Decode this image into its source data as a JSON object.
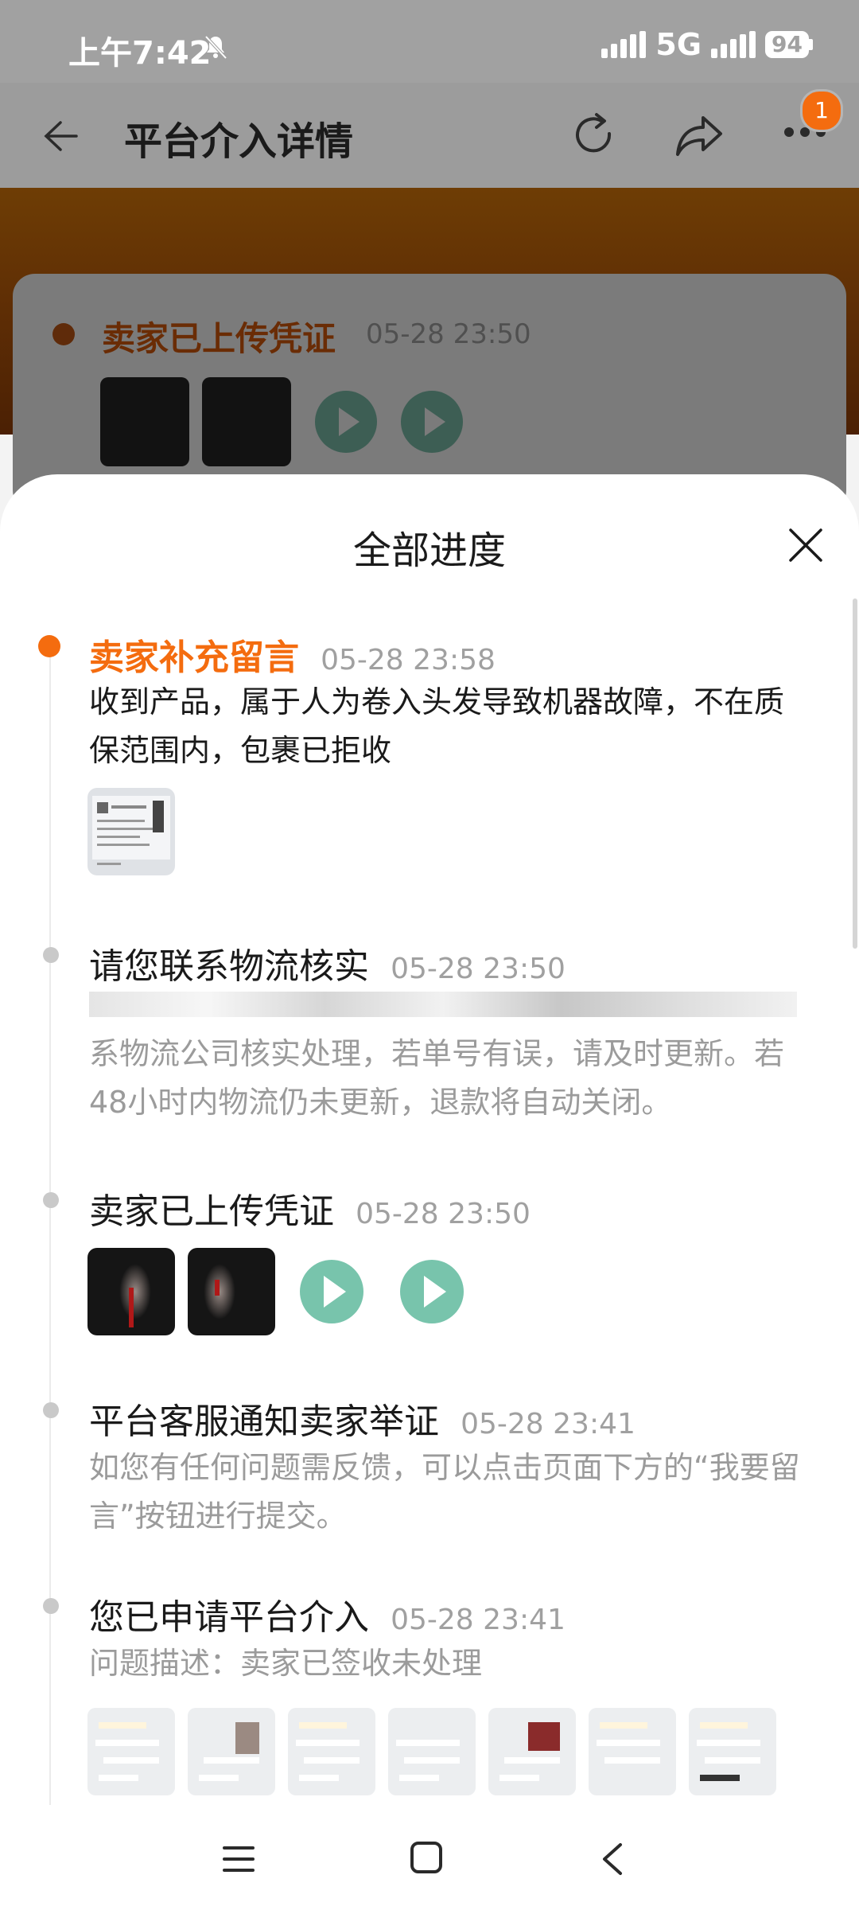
{
  "status_bar": {
    "time": "上午7:42",
    "network": "5G",
    "battery": "94"
  },
  "header": {
    "title": "平台介入详情",
    "badge_count": "1"
  },
  "background_card": {
    "title": "卖家已上传凭证",
    "time": "05-28 23:50"
  },
  "sheet": {
    "title": "全部进度",
    "items": [
      {
        "title": "卖家补充留言",
        "time": "05-28 23:58",
        "desc": "收到产品，属于人为卷入头发导致机器故障，不在质保范围内，包裹已拒收"
      },
      {
        "title": "请您联系物流核实",
        "time": "05-28 23:50",
        "desc": "系物流公司核实处理，若单号有误，请及时更新。若48小时内物流仍未更新，退款将自动关闭。"
      },
      {
        "title": "卖家已上传凭证",
        "time": "05-28 23:50"
      },
      {
        "title": "平台客服通知卖家举证",
        "time": "05-28 23:41",
        "desc": "如您有任何问题需反馈，可以点击页面下方的“我要留言”按钮进行提交。"
      },
      {
        "title": "您已申请平台介入",
        "time": "05-28 23:41",
        "desc": "问题描述：卖家已签收未处理"
      }
    ]
  },
  "colors": {
    "accent": "#f46c0f",
    "play": "#78c4ac"
  }
}
